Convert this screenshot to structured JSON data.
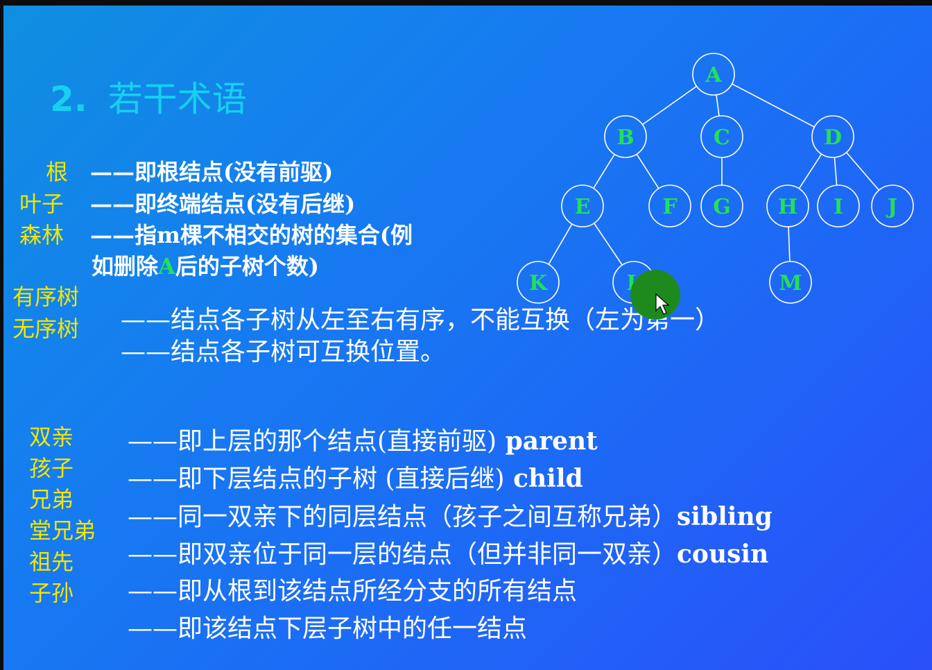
{
  "title": {
    "number": "2.",
    "text": "若干术语"
  },
  "terms1": [
    {
      "term": "根",
      "desc": "——即根结点(没有前驱)"
    },
    {
      "term": "叶子",
      "desc": "——即终端结点(没有后继)"
    },
    {
      "term": "森林",
      "desc": "——指m棵不相交的树的集合(例"
    }
  ],
  "forest_cont": {
    "pre": "如删除",
    "hl": "A",
    "post": "后的子树个数)"
  },
  "ordered": {
    "term1": "有序树",
    "term2": "无序树",
    "desc1": "——结点各子树从左至右有序，不能互换（左为第一）",
    "desc2": "——结点各子树可互换位置。"
  },
  "terms2": [
    {
      "term": "双亲",
      "desc": "——即上层的那个结点(直接前驱)",
      "en": " parent"
    },
    {
      "term": "孩子",
      "desc": "——即下层结点的子树 (直接后继)",
      "en": " child"
    },
    {
      "term": "兄弟",
      "desc": "——同一双亲下的同层结点（孩子之间互称兄弟）",
      "en": "sibling"
    },
    {
      "term": "堂兄弟",
      "desc": "——即双亲位于同一层的结点（但并非同一双亲）",
      "en": "cousin"
    },
    {
      "term": "祖先",
      "desc": "——即从根到该结点所经分支的所有结点",
      "en": ""
    },
    {
      "term": "子孙",
      "desc": "——即该结点下层子树中的任一结点",
      "en": ""
    }
  ],
  "tree": {
    "nodes": [
      "A",
      "B",
      "C",
      "D",
      "E",
      "F",
      "G",
      "H",
      "I",
      "J",
      "K",
      "L",
      "M"
    ],
    "node_color": "#23e05a",
    "edge_color": "#ffffff",
    "edges": [
      [
        "A",
        "B"
      ],
      [
        "A",
        "C"
      ],
      [
        "A",
        "D"
      ],
      [
        "B",
        "E"
      ],
      [
        "B",
        "F"
      ],
      [
        "C",
        "G"
      ],
      [
        "D",
        "H"
      ],
      [
        "D",
        "I"
      ],
      [
        "D",
        "J"
      ],
      [
        "E",
        "K"
      ],
      [
        "E",
        "L"
      ],
      [
        "H",
        "M"
      ]
    ]
  },
  "cursor_highlight_color": "#1e8a1e"
}
